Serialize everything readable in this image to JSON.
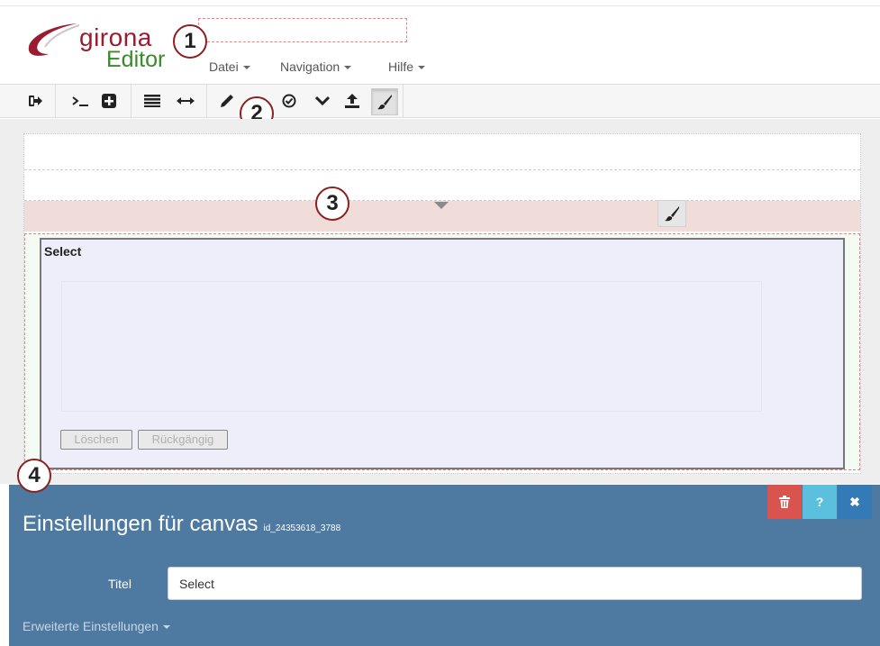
{
  "header": {
    "logo_line1": "girona",
    "logo_line2": "Editor",
    "menu": [
      {
        "label": "Datei"
      },
      {
        "label": "Navigation"
      },
      {
        "label": "Hilfe"
      }
    ]
  },
  "toolbar": {
    "icons": [
      "sign-out-icon",
      "terminal-icon",
      "plus-square-icon",
      "list-icon",
      "arrows-horizontal-icon",
      "pencil-icon",
      "check-circle-icon",
      "chevron-down-icon",
      "upload-icon",
      "paintbrush-icon"
    ]
  },
  "badges": [
    "1",
    "2",
    "3",
    "4"
  ],
  "canvas": {
    "select_label": "Select",
    "delete_label": "Löschen",
    "undo_label": "Rückgängig"
  },
  "settings": {
    "title": "Einstellungen für canvas",
    "id": "id_24353618_3788",
    "delete_icon": "trash-icon",
    "help_label": "?",
    "close_label": "✖",
    "titel_label": "Titel",
    "titel_value": "Select",
    "advanced_label": "Erweiterte Einstellungen"
  },
  "colors": {
    "panel": "#4e79a0",
    "danger": "#d9534f",
    "info": "#5bc0de",
    "primary": "#337ab7",
    "logo_red": "#9b1b30",
    "logo_green": "#3a8a2a"
  }
}
